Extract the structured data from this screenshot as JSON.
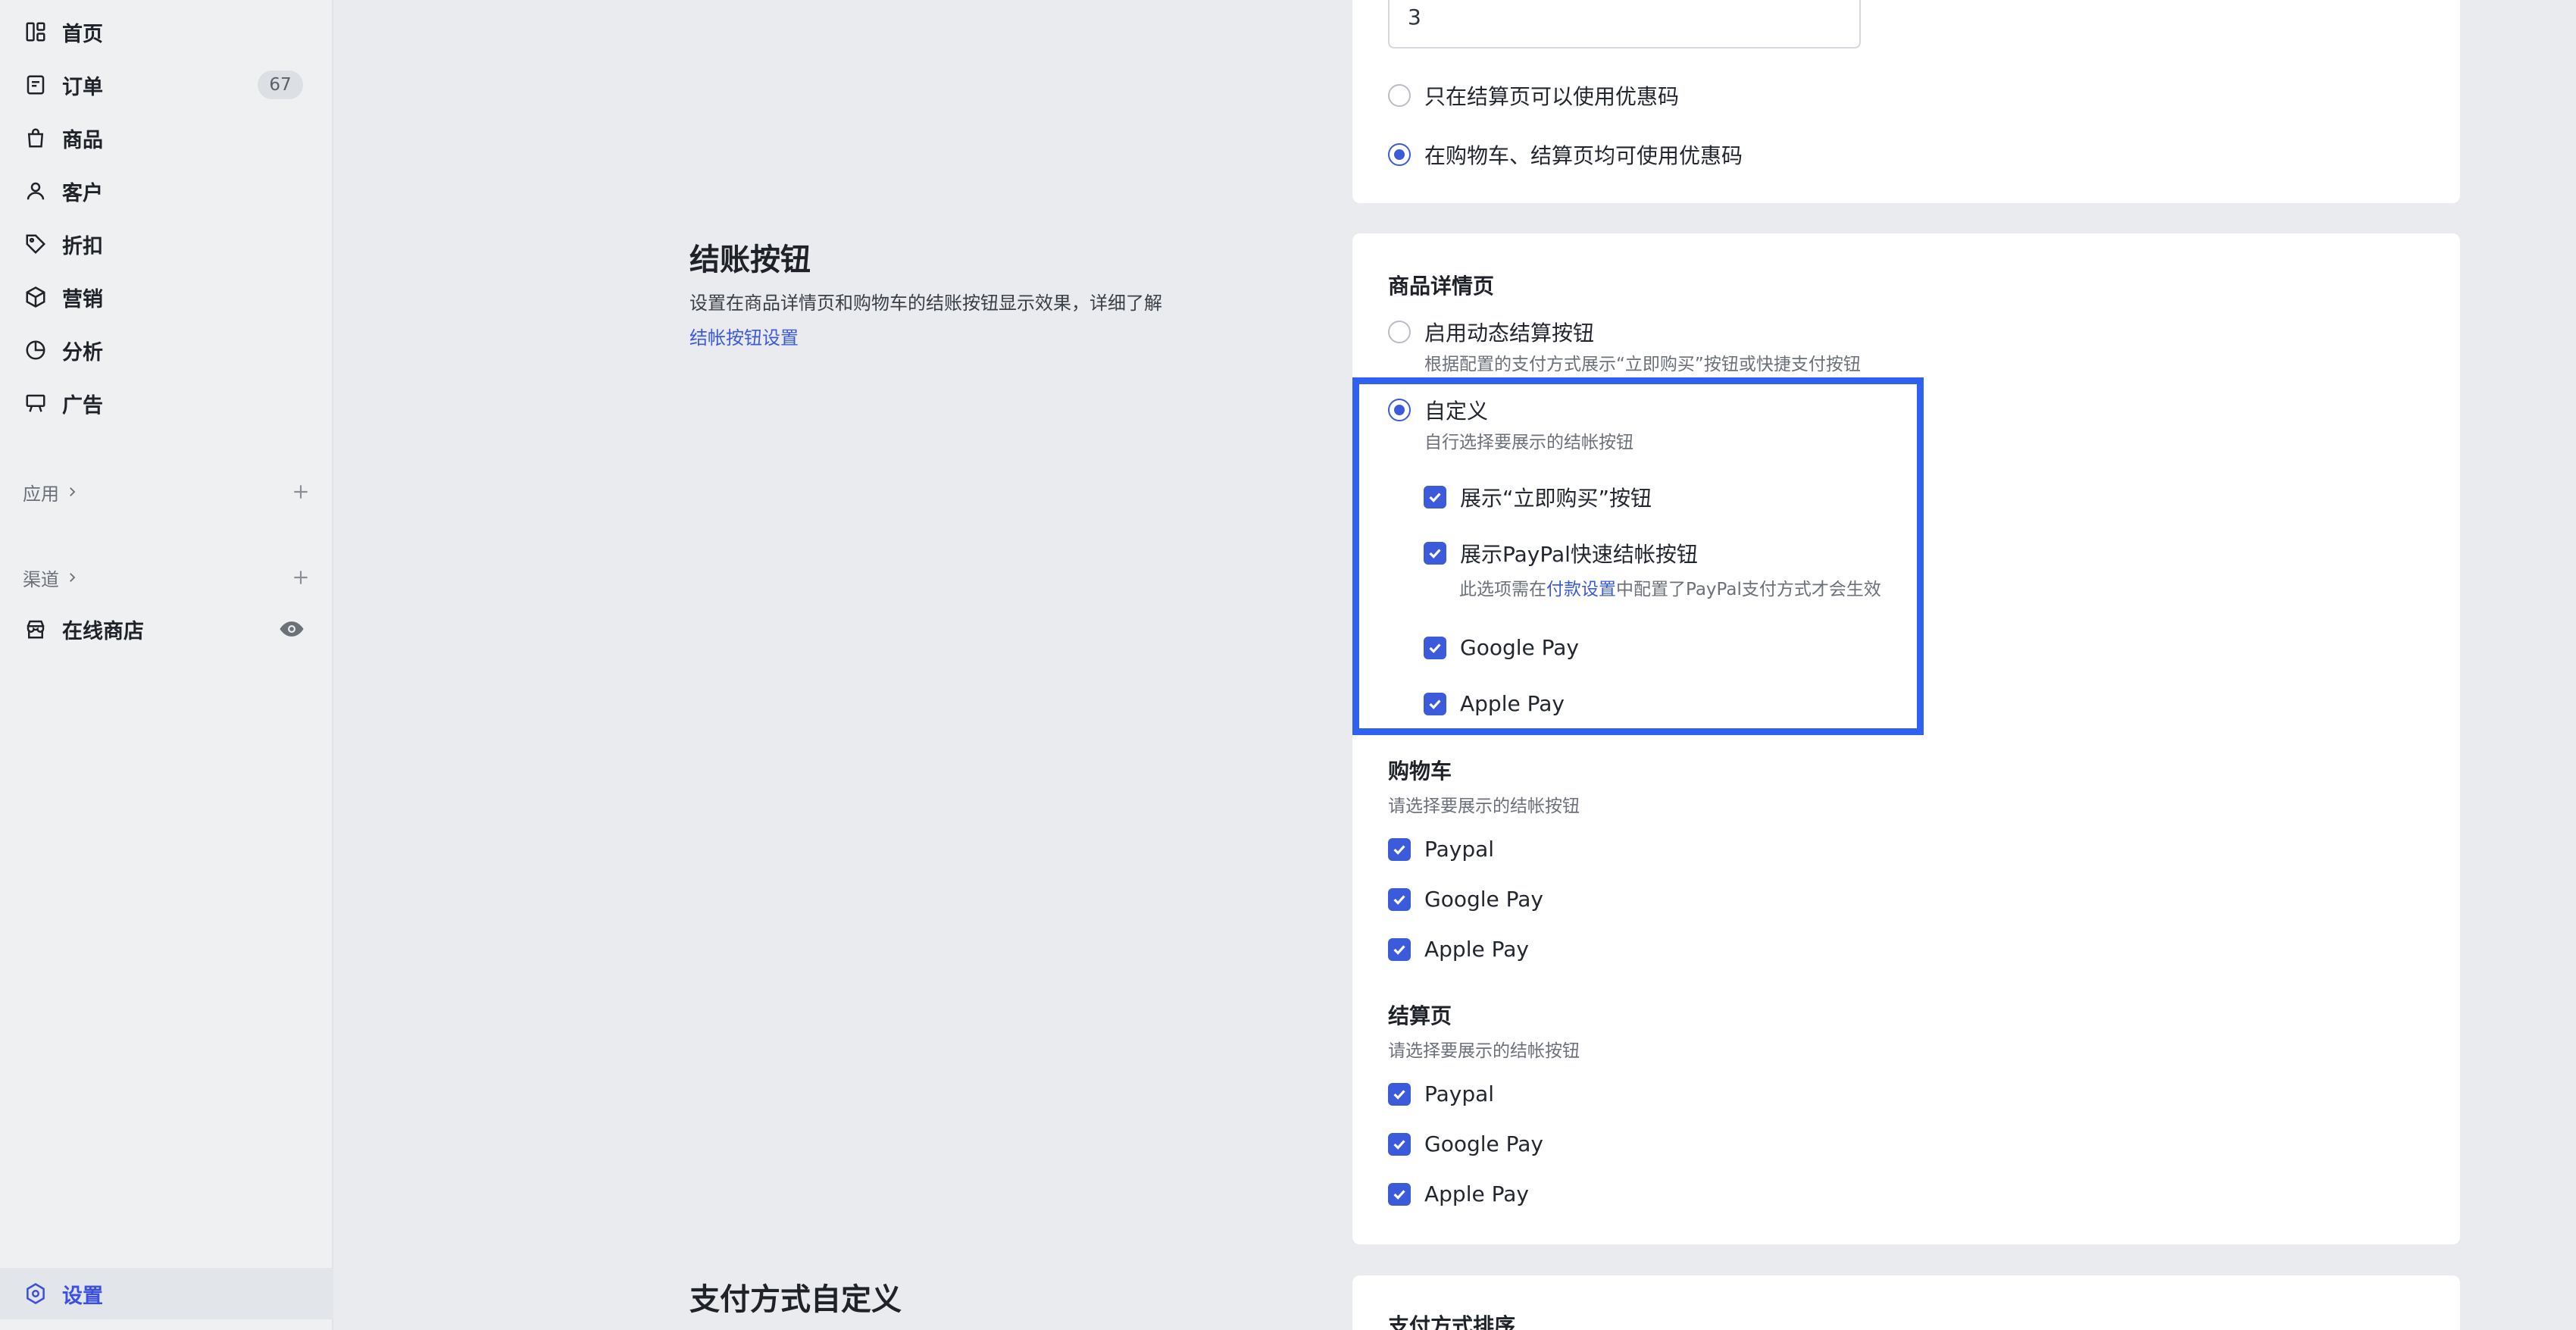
{
  "sidebar": {
    "items": [
      {
        "label": "首页",
        "icon": "dashboard-icon"
      },
      {
        "label": "订单",
        "icon": "order-icon",
        "badge": "67"
      },
      {
        "label": "商品",
        "icon": "bag-icon"
      },
      {
        "label": "客户",
        "icon": "user-icon"
      },
      {
        "label": "折扣",
        "icon": "tag-icon"
      },
      {
        "label": "营销",
        "icon": "box-icon"
      },
      {
        "label": "分析",
        "icon": "pie-chart-icon"
      },
      {
        "label": "广告",
        "icon": "billboard-icon"
      }
    ],
    "apps_label": "应用",
    "channels_label": "渠道",
    "store_label": "在线商店",
    "settings_label": "设置"
  },
  "discount": {
    "input_value": "3",
    "option_checkout_only": "只在结算页可以使用优惠码",
    "option_cart_and_checkout": "在购物车、结算页均可使用优惠码",
    "selected": "option_cart_and_checkout"
  },
  "checkout_button": {
    "title": "结账按钮",
    "desc": "设置在商品详情页和购物车的结账按钮显示效果，详细了解",
    "link": "结帐按钮设置",
    "product_page": {
      "heading": "商品详情页",
      "dynamic_label": "启用动态结算按钮",
      "dynamic_hint": "根据配置的支付方式展示“立即购买”按钮或快捷支付按钮",
      "custom_label": "自定义",
      "custom_hint": "自行选择要展示的结帐按钮",
      "show_buy_now": "展示“立即购买”按钮",
      "show_paypal": "展示PayPal快速结帐按钮",
      "paypal_hint_pre": "此选项需在",
      "paypal_hint_link": "付款设置",
      "paypal_hint_post": "中配置了PayPal支付方式才会生效",
      "google_pay": "Google Pay",
      "apple_pay": "Apple Pay"
    },
    "cart": {
      "heading": "购物车",
      "hint": "请选择要展示的结帐按钮",
      "options": [
        "Paypal",
        "Google Pay",
        "Apple Pay"
      ]
    },
    "checkout": {
      "heading": "结算页",
      "hint": "请选择要展示的结帐按钮",
      "options": [
        "Paypal",
        "Google Pay",
        "Apple Pay"
      ]
    }
  },
  "payment_custom": {
    "title": "支付方式自定义",
    "sort_heading": "支付方式排序"
  },
  "colors": {
    "accent": "#3b5bdb",
    "highlight": "#2f62f0"
  }
}
